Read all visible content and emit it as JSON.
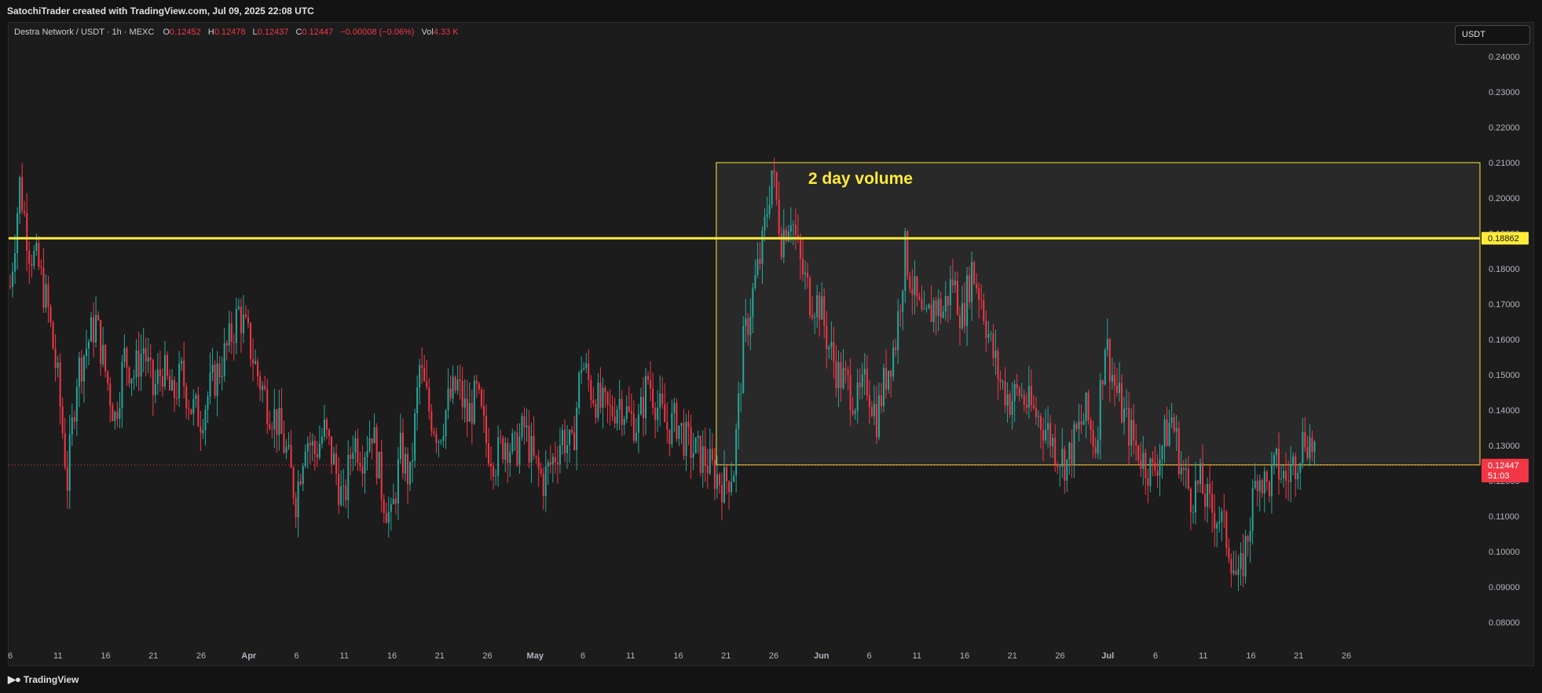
{
  "header": {
    "attribution": "SatochiTrader created with TradingView.com, Jul 09, 2025 22:08 UTC"
  },
  "legend": {
    "symbol": "Destra Network / USDT · 1h · MEXC",
    "open_label": "O",
    "open": "0.12452",
    "high_label": "H",
    "high": "0.12478",
    "low_label": "L",
    "low": "0.12437",
    "close_label": "C",
    "close": "0.12447",
    "change": "−0.00008 (−0.06%)",
    "vol_label": "Vol",
    "vol": "4.33 K"
  },
  "toolbar": {
    "currency": "USDT"
  },
  "footer": {
    "brand": "TradingView"
  },
  "chart_data": {
    "type": "candlestick",
    "pair": "Destra Network / USDT",
    "interval": "1h",
    "exchange": "MEXC",
    "y_axis": {
      "range": [
        0.075,
        0.245
      ],
      "ticks": [
        "0.24000",
        "0.23000",
        "0.22000",
        "0.21000",
        "0.20000",
        "0.19000",
        "0.18000",
        "0.17000",
        "0.16000",
        "0.15000",
        "0.14000",
        "0.13000",
        "0.12000",
        "0.11000",
        "0.10000",
        "0.09000",
        "0.08000"
      ]
    },
    "x_axis": {
      "ticks": [
        "6",
        "11",
        "16",
        "21",
        "26",
        "Apr",
        "6",
        "11",
        "16",
        "21",
        "26",
        "May",
        "6",
        "11",
        "16",
        "21",
        "26",
        "Jun",
        "6",
        "11",
        "16",
        "21",
        "26",
        "Jul",
        "6",
        "11",
        "16",
        "21",
        "26"
      ],
      "major": [
        "Apr",
        "May",
        "Jun",
        "Jul"
      ],
      "range_days": [
        0,
        137
      ]
    },
    "price_path": [
      [
        0,
        0.175
      ],
      [
        1,
        0.204
      ],
      [
        2,
        0.186
      ],
      [
        3,
        0.18
      ],
      [
        4,
        0.168
      ],
      [
        5,
        0.148
      ],
      [
        6,
        0.12
      ],
      [
        7,
        0.15
      ],
      [
        8,
        0.158
      ],
      [
        9,
        0.165
      ],
      [
        10,
        0.151
      ],
      [
        11,
        0.138
      ],
      [
        12,
        0.155
      ],
      [
        13,
        0.15
      ],
      [
        14,
        0.158
      ],
      [
        15,
        0.145
      ],
      [
        16,
        0.152
      ],
      [
        17,
        0.143
      ],
      [
        18,
        0.15
      ],
      [
        19,
        0.141
      ],
      [
        20,
        0.138
      ],
      [
        21,
        0.146
      ],
      [
        22,
        0.152
      ],
      [
        23,
        0.159
      ],
      [
        24,
        0.168
      ],
      [
        25,
        0.16
      ],
      [
        26,
        0.15
      ],
      [
        27,
        0.142
      ],
      [
        28,
        0.137
      ],
      [
        29,
        0.128
      ],
      [
        30,
        0.115
      ],
      [
        31,
        0.133
      ],
      [
        32,
        0.128
      ],
      [
        33,
        0.134
      ],
      [
        34,
        0.125
      ],
      [
        35,
        0.113
      ],
      [
        36,
        0.132
      ],
      [
        37,
        0.128
      ],
      [
        38,
        0.135
      ],
      [
        39,
        0.118
      ],
      [
        40,
        0.108
      ],
      [
        41,
        0.128
      ],
      [
        42,
        0.12
      ],
      [
        43,
        0.152
      ],
      [
        44,
        0.14
      ],
      [
        45,
        0.133
      ],
      [
        46,
        0.142
      ],
      [
        47,
        0.147
      ],
      [
        48,
        0.138
      ],
      [
        49,
        0.144
      ],
      [
        50,
        0.131
      ],
      [
        51,
        0.126
      ],
      [
        52,
        0.132
      ],
      [
        53,
        0.128
      ],
      [
        54,
        0.135
      ],
      [
        55,
        0.125
      ],
      [
        56,
        0.12
      ],
      [
        57,
        0.126
      ],
      [
        58,
        0.133
      ],
      [
        59,
        0.128
      ],
      [
        60,
        0.154
      ],
      [
        61,
        0.146
      ],
      [
        62,
        0.141
      ],
      [
        63,
        0.139
      ],
      [
        64,
        0.143
      ],
      [
        65,
        0.138
      ],
      [
        66,
        0.136
      ],
      [
        67,
        0.149
      ],
      [
        68,
        0.141
      ],
      [
        69,
        0.135
      ],
      [
        70,
        0.137
      ],
      [
        71,
        0.131
      ],
      [
        72,
        0.128
      ],
      [
        73,
        0.126
      ],
      [
        74,
        0.122
      ],
      [
        75,
        0.119
      ],
      [
        76,
        0.124
      ],
      [
        77,
        0.158
      ],
      [
        78,
        0.173
      ],
      [
        79,
        0.186
      ],
      [
        80,
        0.208
      ],
      [
        81,
        0.189
      ],
      [
        82,
        0.196
      ],
      [
        83,
        0.181
      ],
      [
        84,
        0.172
      ],
      [
        85,
        0.17
      ],
      [
        86,
        0.158
      ],
      [
        87,
        0.15
      ],
      [
        88,
        0.147
      ],
      [
        89,
        0.142
      ],
      [
        90,
        0.148
      ],
      [
        91,
        0.138
      ],
      [
        92,
        0.15
      ],
      [
        93,
        0.16
      ],
      [
        94,
        0.185
      ],
      [
        95,
        0.172
      ],
      [
        96,
        0.163
      ],
      [
        97,
        0.17
      ],
      [
        98,
        0.168
      ],
      [
        99,
        0.177
      ],
      [
        100,
        0.166
      ],
      [
        101,
        0.18
      ],
      [
        102,
        0.172
      ],
      [
        103,
        0.158
      ],
      [
        104,
        0.148
      ],
      [
        105,
        0.143
      ],
      [
        106,
        0.145
      ],
      [
        107,
        0.141
      ],
      [
        108,
        0.138
      ],
      [
        109,
        0.134
      ],
      [
        110,
        0.128
      ],
      [
        111,
        0.125
      ],
      [
        112,
        0.133
      ],
      [
        113,
        0.139
      ],
      [
        114,
        0.13
      ],
      [
        115,
        0.16
      ],
      [
        116,
        0.147
      ],
      [
        117,
        0.138
      ],
      [
        118,
        0.131
      ],
      [
        119,
        0.126
      ],
      [
        120,
        0.122
      ],
      [
        121,
        0.13
      ],
      [
        122,
        0.138
      ],
      [
        123,
        0.124
      ],
      [
        124,
        0.116
      ],
      [
        125,
        0.119
      ],
      [
        126,
        0.112
      ],
      [
        127,
        0.11
      ],
      [
        128,
        0.102
      ],
      [
        129,
        0.09
      ],
      [
        130,
        0.105
      ],
      [
        131,
        0.123
      ],
      [
        132,
        0.118
      ],
      [
        133,
        0.124
      ],
      [
        134,
        0.12
      ],
      [
        135,
        0.126
      ],
      [
        136,
        0.133
      ],
      [
        137,
        0.129
      ]
    ],
    "horizontal_line": {
      "price": 0.18862,
      "label": "0.18862",
      "color": "#ffeb3b"
    },
    "last_price": {
      "price": 0.12447,
      "label": "0.12447",
      "countdown": "51:03",
      "color": "#f23645"
    },
    "range_box": {
      "label": "2 day volume",
      "from_day": 74,
      "to_day": 137,
      "top": 0.21,
      "bottom": 0.1245,
      "color": "#ffeb3b"
    },
    "colors": {
      "up": "#26a69a",
      "down": "#f23645",
      "grid": "#2a2a2a",
      "axis_text": "#b2b5be"
    }
  }
}
